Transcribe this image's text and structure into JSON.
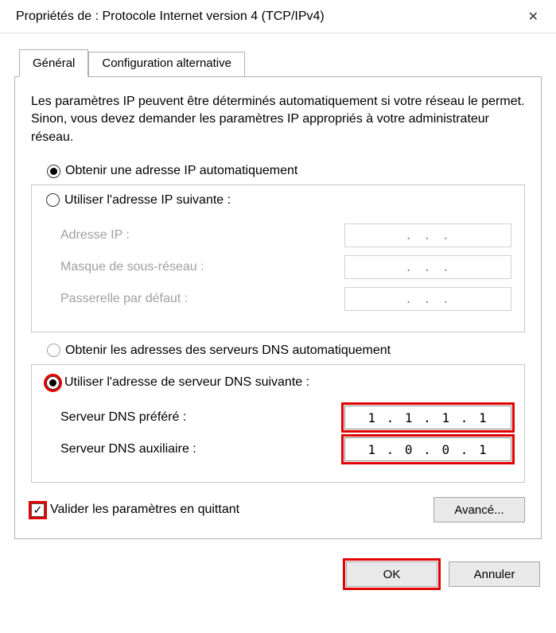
{
  "titlebar": {
    "title": "Propriétés de : Protocole Internet version 4 (TCP/IPv4)"
  },
  "tabs": {
    "general": "Général",
    "alt": "Configuration alternative"
  },
  "intro": "Les paramètres IP peuvent être déterminés automatiquement si votre réseau le permet. Sinon, vous devez demander les paramètres IP appropriés à votre administrateur réseau.",
  "ip": {
    "auto_label": "Obtenir une adresse IP automatiquement",
    "manual_label": "Utiliser l'adresse IP suivante :",
    "address": "Adresse IP :",
    "mask": "Masque de sous-réseau :",
    "gateway": "Passerelle par défaut :",
    "dots": ".     .     ."
  },
  "dns": {
    "auto_label": "Obtenir les adresses des serveurs DNS automatiquement",
    "manual_label": "Utiliser l'adresse de serveur DNS suivante :",
    "pref": "Serveur DNS préféré :",
    "alt": "Serveur DNS auxiliaire :",
    "pref_value": "1  .  1  .  1  .  1",
    "alt_value": "1  .  0  .  0  .  1"
  },
  "validate_label": "Valider les paramètres en quittant",
  "buttons": {
    "advanced": "Avancé...",
    "ok": "OK",
    "cancel": "Annuler"
  }
}
